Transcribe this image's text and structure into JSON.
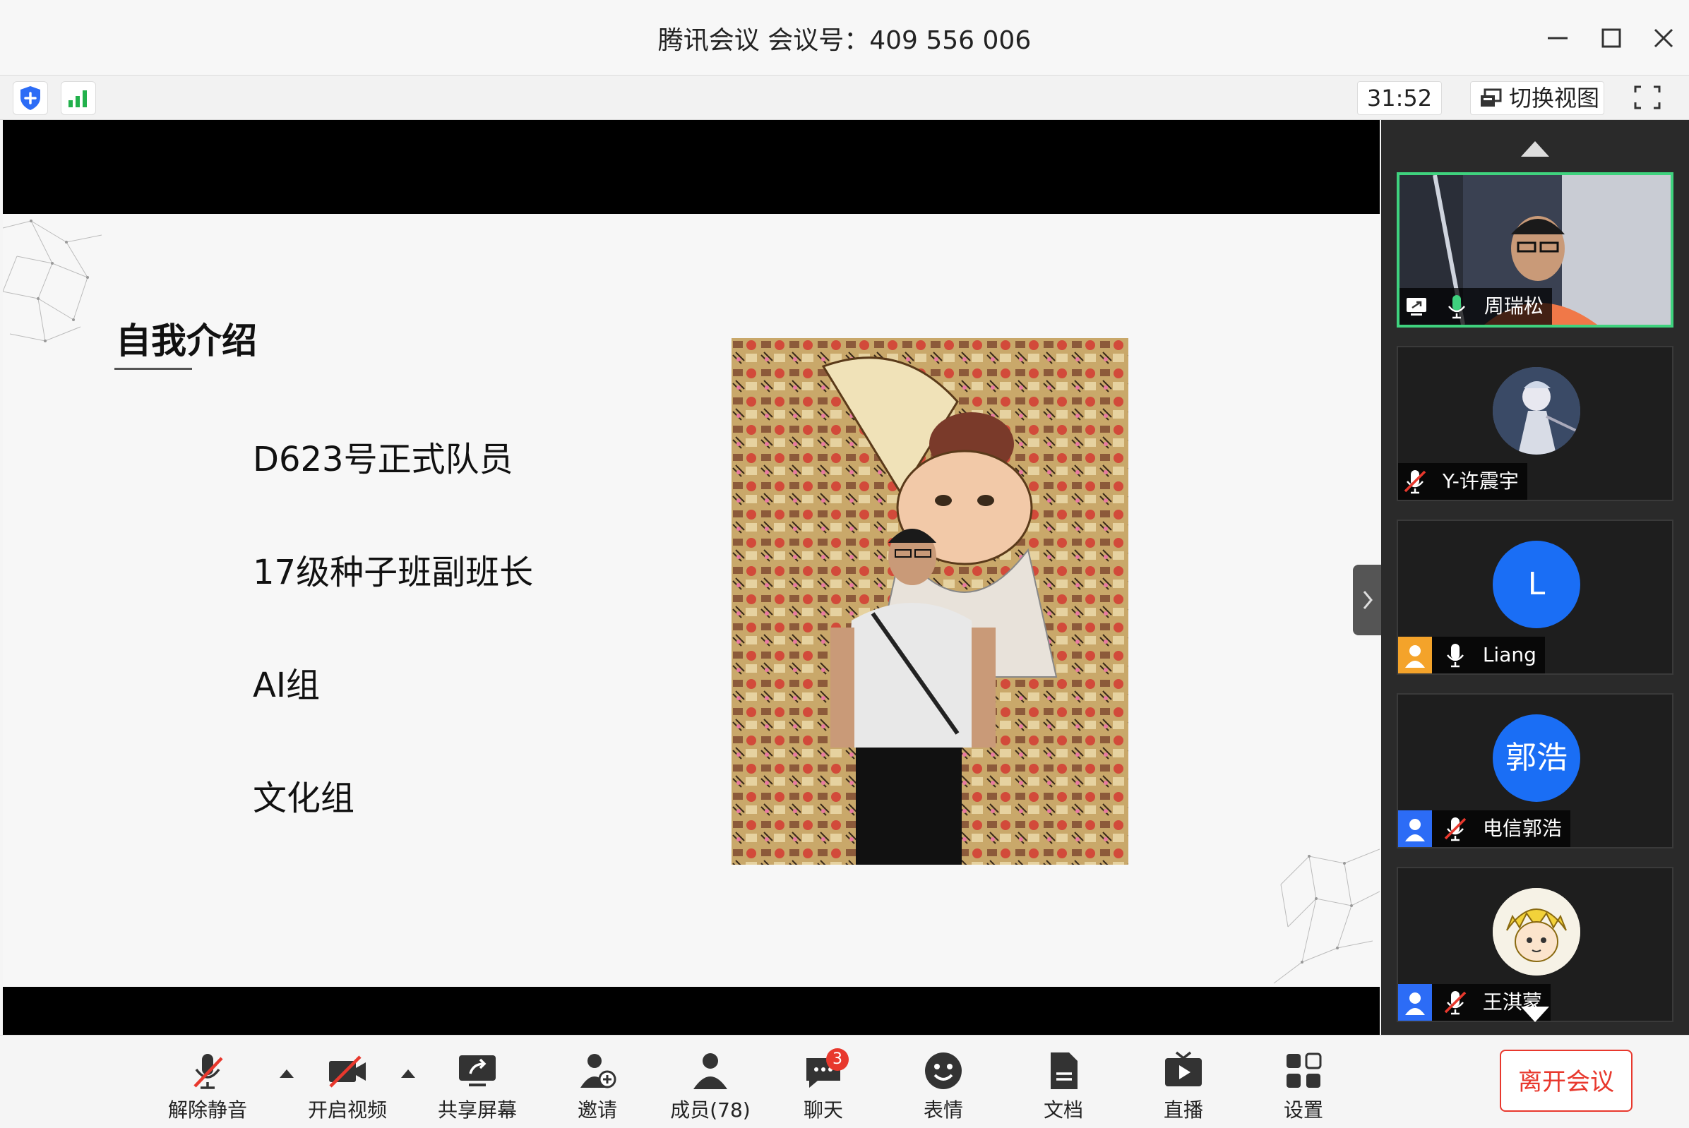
{
  "window": {
    "title": "腾讯会议 会议号：409 556 006"
  },
  "toolbar": {
    "timer": "31:52",
    "switch_view_label": "切换视图"
  },
  "slide": {
    "title": "自我介绍",
    "bullets": [
      "D623号正式队员",
      "17级种子班副班长",
      "AI组",
      "文化组"
    ]
  },
  "participants": [
    {
      "name": "周瑞松",
      "mic": "on",
      "video": true,
      "active": true
    },
    {
      "name": "Y-许震宇",
      "mic": "muted",
      "avatar": "image"
    },
    {
      "name": "Liang",
      "mic": "on",
      "avatar_text": "L",
      "avatar_color": "#1a6ef5"
    },
    {
      "name": "电信郭浩",
      "mic": "muted",
      "avatar_text": "郭浩",
      "avatar_color": "#1a6ef5"
    },
    {
      "name": "王淇蒙",
      "mic": "muted",
      "avatar": "image"
    }
  ],
  "bottombar": {
    "unmute": "解除静音",
    "start_video": "开启视频",
    "share_screen": "共享屏幕",
    "invite": "邀请",
    "members": "成员(78)",
    "chat": "聊天",
    "chat_badge": "3",
    "reactions": "表情",
    "docs": "文档",
    "live": "直播",
    "settings": "设置",
    "leave": "离开会议"
  },
  "colors": {
    "accent_green": "#3fd27e",
    "blue": "#1a6ef5",
    "leave_red": "#e8382d"
  }
}
